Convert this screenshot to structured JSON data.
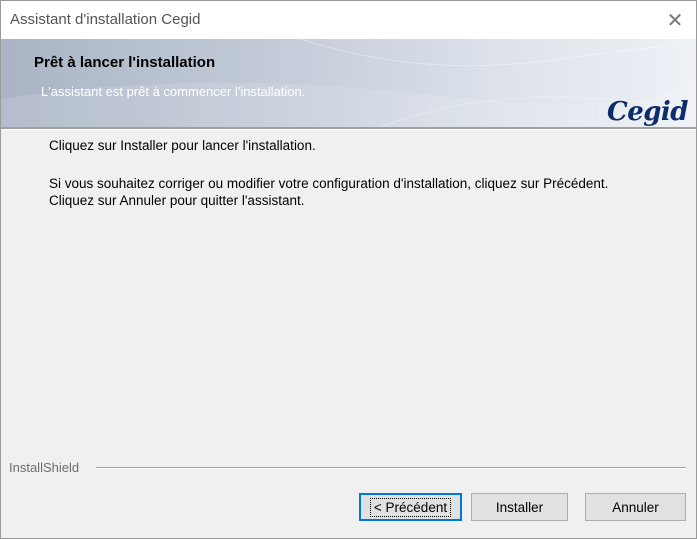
{
  "window": {
    "title": "Assistant d'installation Cegid",
    "close_glyph": "✕"
  },
  "banner": {
    "title": "Prêt à lancer l'installation",
    "subtitle": "L'assistant est prêt à commencer l'installation.",
    "logo": "Cegid"
  },
  "content": {
    "line1": "Cliquez sur Installer pour lancer l'installation.",
    "line2": "Si vous souhaitez corriger ou modifier votre configuration d'installation, cliquez sur Précédent.",
    "line3": "Cliquez sur Annuler pour quitter l'assistant."
  },
  "group": {
    "label": "InstallShield"
  },
  "buttons": {
    "back": "< Précédent",
    "install": "Installer",
    "cancel": "Annuler"
  },
  "colors": {
    "accent": "#0078d7",
    "logo": "#0d2c6b"
  },
  "icons": [
    "close-icon"
  ]
}
